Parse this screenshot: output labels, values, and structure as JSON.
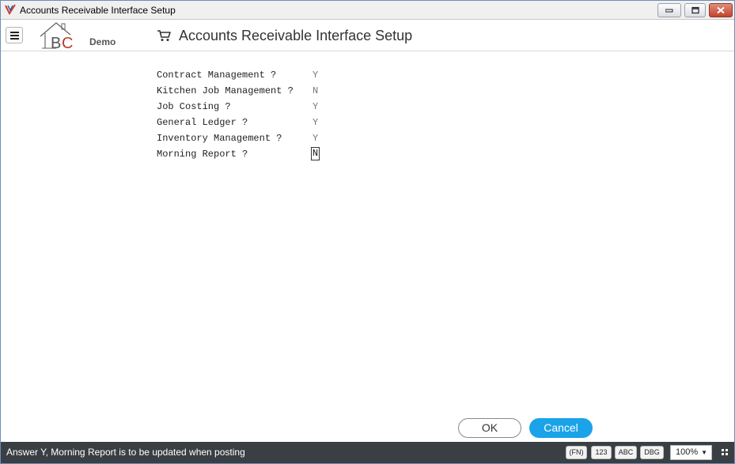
{
  "window": {
    "title": "Accounts Receivable Interface Setup"
  },
  "header": {
    "logo_letters": "BC",
    "logo_text": "Demo",
    "page_title": "Accounts Receivable Interface Setup"
  },
  "form": {
    "rows": [
      {
        "label": "Contract Management ?",
        "value": "Y"
      },
      {
        "label": "Kitchen Job Management ?",
        "value": "N"
      },
      {
        "label": "Job Costing ?",
        "value": "Y"
      },
      {
        "label": "General Ledger ?",
        "value": "Y"
      },
      {
        "label": "Inventory Management ?",
        "value": "Y"
      },
      {
        "label": "Morning Report ?",
        "value": "N"
      }
    ]
  },
  "buttons": {
    "ok": "OK",
    "cancel": "Cancel"
  },
  "status": {
    "message": "Answer Y, Morning Report is to be updated when posting",
    "fn": "(FN)",
    "num": "123",
    "abc": "ABC",
    "dbg": "DBG",
    "zoom": "100%"
  },
  "colors": {
    "accent": "#1aa3e8",
    "statusbar": "#3a3f44",
    "logo_red": "#c0392b"
  },
  "icons": {
    "menu": "hamburger-icon",
    "cart": "cart-icon",
    "grid": "grid-icon"
  }
}
